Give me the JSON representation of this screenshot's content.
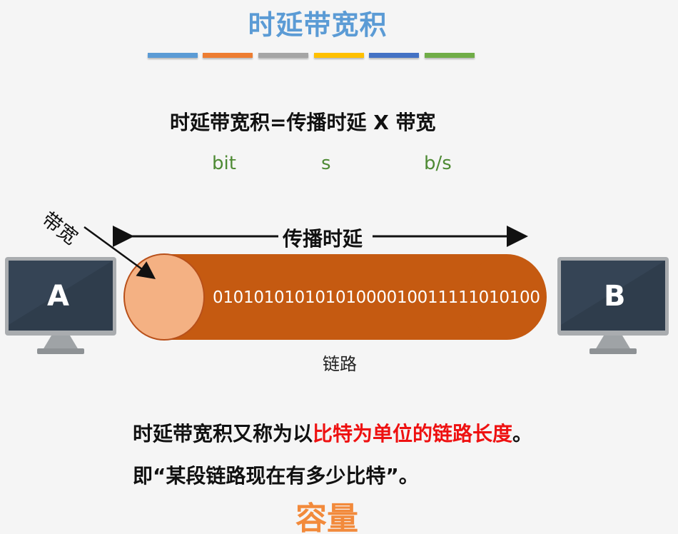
{
  "title": "时延带宽积",
  "accent_colors": [
    "#5b9bd5",
    "#ed7d31",
    "#a5a5a5",
    "#ffc000",
    "#4472c4",
    "#70ad47"
  ],
  "formula": "时延带宽积=传播时延 X 带宽",
  "units": {
    "delay_bandwidth_product": "bit",
    "propagation_delay": "s",
    "bandwidth": "b/s"
  },
  "diagram": {
    "bandwidth_label": "带宽",
    "propagation_delay_label": "传播时延",
    "bits": "01010101010101000010011111010100",
    "link_label": "链路",
    "host_a": "A",
    "host_b": "B",
    "pipe_color": "#c55a11",
    "pipe_end_color": "#f4b183"
  },
  "description": {
    "line1_prefix": "时延带宽积又称为以",
    "line1_highlight": "比特为单位的链路长度",
    "line1_suffix": "。",
    "line2": "即“某段链路现在有多少比特”。",
    "capacity": "容量"
  }
}
